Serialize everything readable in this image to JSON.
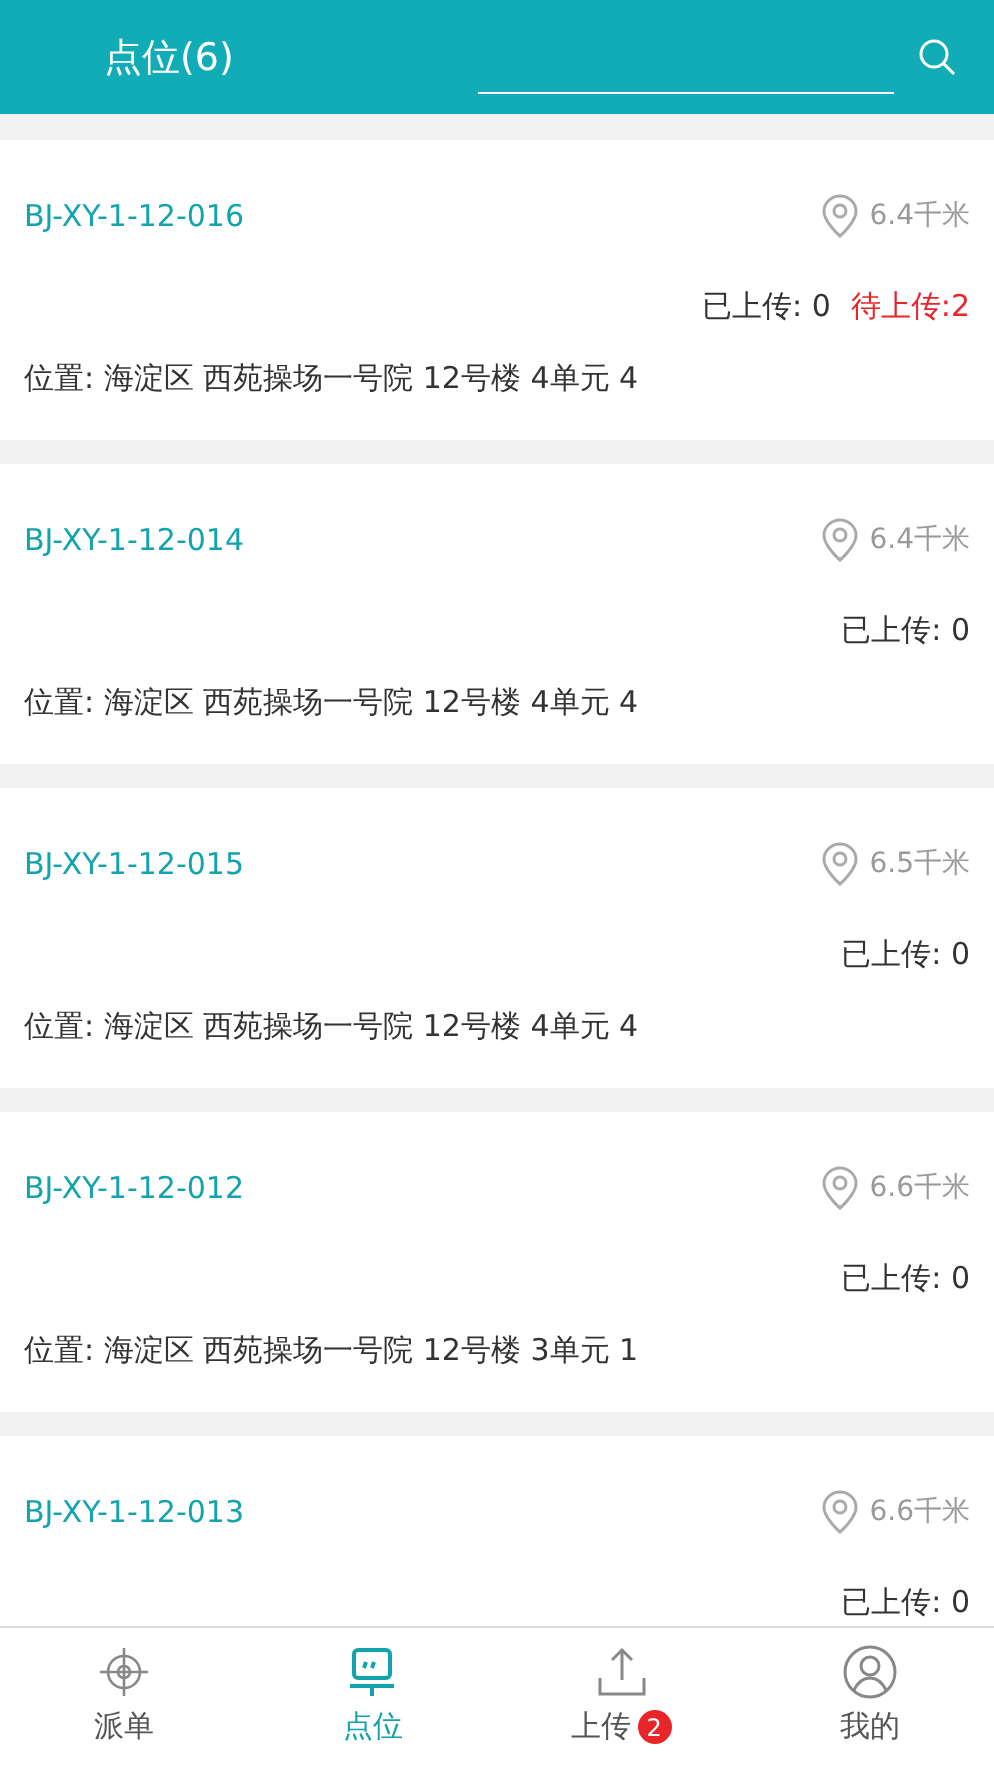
{
  "header": {
    "title": "点位(6)"
  },
  "points": [
    {
      "code": "BJ-XY-1-12-016",
      "distance": "6.4千米",
      "uploaded": "已上传: 0",
      "pending": "待上传:2",
      "address": "位置: 海淀区 西苑操场一号院 12号楼 4单元 4"
    },
    {
      "code": "BJ-XY-1-12-014",
      "distance": "6.4千米",
      "uploaded": "已上传: 0",
      "address": "位置: 海淀区 西苑操场一号院 12号楼 4单元 4"
    },
    {
      "code": "BJ-XY-1-12-015",
      "distance": "6.5千米",
      "uploaded": "已上传: 0",
      "address": "位置: 海淀区 西苑操场一号院 12号楼 4单元 4"
    },
    {
      "code": "BJ-XY-1-12-012",
      "distance": "6.6千米",
      "uploaded": "已上传: 0",
      "address": "位置: 海淀区 西苑操场一号院 12号楼 3单元 1"
    },
    {
      "code": "BJ-XY-1-12-013",
      "distance": "6.6千米",
      "uploaded": "已上传: 0"
    }
  ],
  "tabbar": [
    {
      "kind": "target",
      "label": "派单",
      "selected": false
    },
    {
      "kind": "board",
      "label": "点位",
      "selected": true
    },
    {
      "kind": "upload",
      "label": "上传",
      "selected": false,
      "badge": "2"
    },
    {
      "kind": "person",
      "label": "我的",
      "selected": false
    }
  ]
}
